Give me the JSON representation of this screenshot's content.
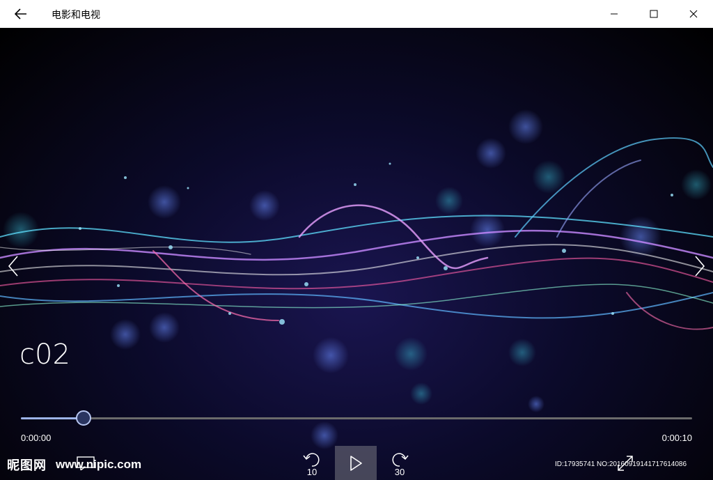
{
  "window": {
    "title": "电影和电视"
  },
  "video": {
    "title": "c02",
    "current_time": "0:00:00",
    "total_time": "0:00:10",
    "progress_fraction": 0.093,
    "skip_back_seconds": "10",
    "skip_forward_seconds": "30"
  },
  "overlay": {
    "watermark_logo": "昵图网",
    "watermark_url": "www.nipic.com",
    "watermark_id": "ID:17935741 NO:20160919141717614086"
  },
  "colors": {
    "titlebar_bg": "#ffffff",
    "seek_fill": "#9db4e8",
    "seek_track": "#6b6b6b"
  },
  "icons": {
    "back": "arrow-left-icon",
    "minimize": "minimize-icon",
    "maximize": "maximize-icon",
    "close": "close-icon",
    "prev": "chevron-left-icon",
    "next": "chevron-right-icon",
    "play": "play-icon",
    "rewind": "skip-back-icon",
    "forward": "skip-forward-icon",
    "fullscreen": "fullscreen-icon",
    "subtitles": "subtitles-icon"
  }
}
